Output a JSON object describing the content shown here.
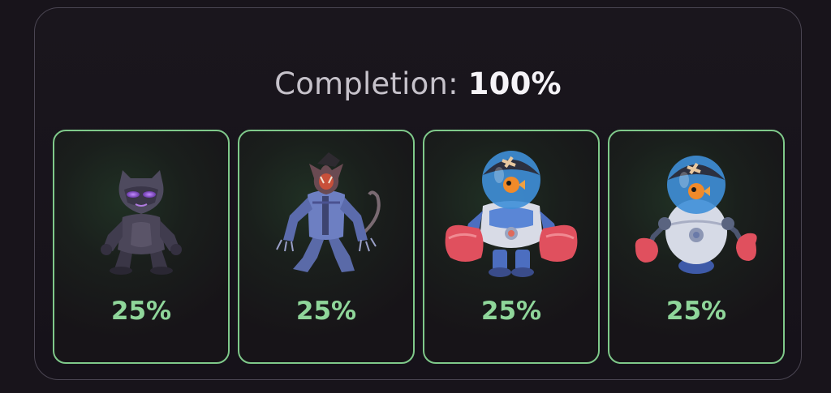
{
  "completion": {
    "label": "Completion:",
    "value": "100%"
  },
  "cards": [
    {
      "character_icon": "black-panther-robot-icon",
      "percent": "25%"
    },
    {
      "character_icon": "werewolf-robot-icon",
      "percent": "25%"
    },
    {
      "character_icon": "boxer-robot-fishbowl-icon",
      "percent": "25%"
    },
    {
      "character_icon": "round-boxer-robot-fishbowl-icon",
      "percent": "25%"
    }
  ],
  "colors": {
    "background": "#18141b",
    "card_border": "#7fc98a",
    "percent_text": "#8fd69a",
    "panel_border": "#4a4552"
  }
}
